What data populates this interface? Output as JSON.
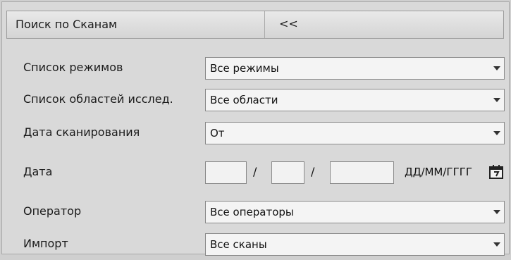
{
  "header": {
    "title": "Поиск по Сканам",
    "collapse_label": "<<"
  },
  "fields": {
    "modes": {
      "label": "Список режимов",
      "value": "Все режимы"
    },
    "areas": {
      "label": "Список областей исслед.",
      "value": "Все области"
    },
    "scan_date": {
      "label": "Дата сканирования",
      "value": "От"
    },
    "date": {
      "label": "Дата",
      "day": "",
      "month": "",
      "year": "",
      "separator": "/",
      "format": "ДД/ММ/ГГГГ"
    },
    "operator": {
      "label": "Оператор",
      "value": "Все операторы"
    },
    "import": {
      "label": "Импорт",
      "value": "Все сканы"
    }
  },
  "icons": {
    "dropdown": "chevron-down-icon",
    "calendar": "calendar-icon"
  },
  "colors": {
    "panel_bg": "#d9d9d9",
    "field_bg": "#f4f4f4",
    "border": "#8a8a8a",
    "text": "#1a1a1a"
  }
}
